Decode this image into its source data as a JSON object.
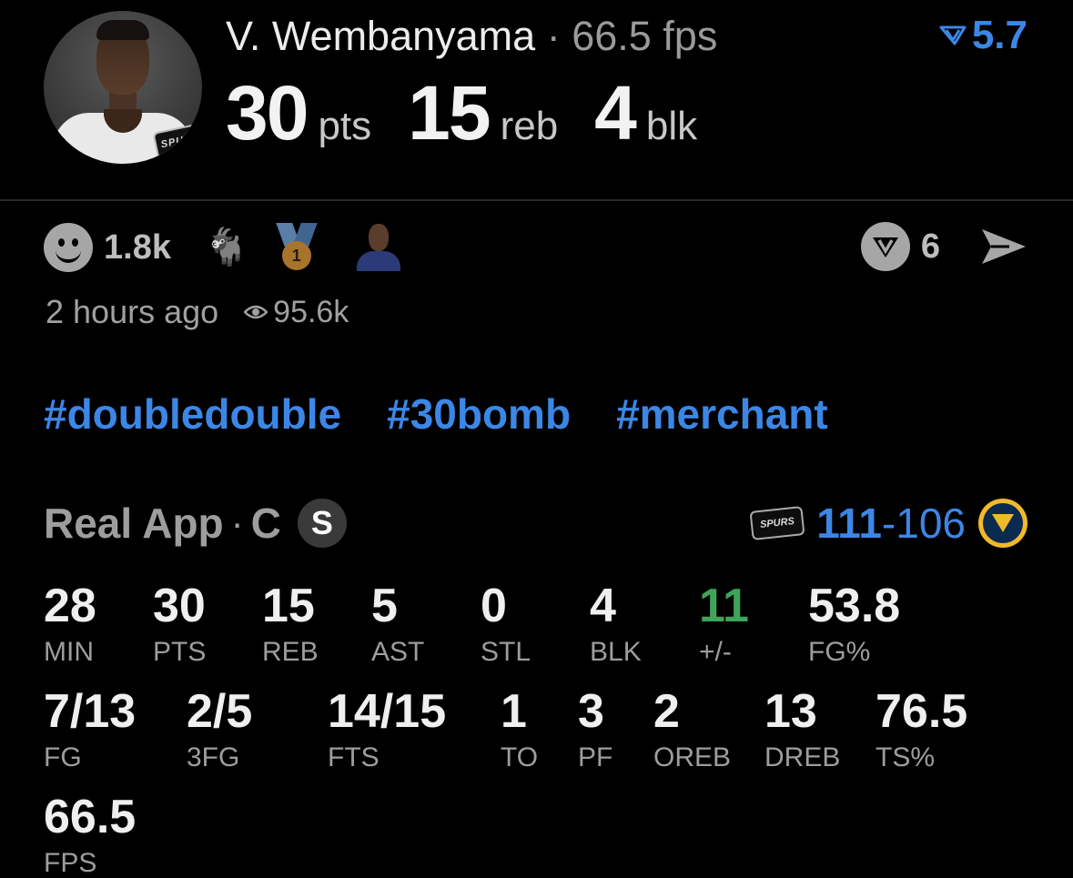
{
  "player": {
    "name": "V. Wembanyama",
    "separator": "·",
    "fps_text": "66.5 fps",
    "rating": "5.7",
    "headline": [
      {
        "value": "30",
        "unit": "pts"
      },
      {
        "value": "15",
        "unit": "reb"
      },
      {
        "value": "4",
        "unit": "blk"
      }
    ],
    "team_badge": "SPURS"
  },
  "reactions": {
    "count": "1.8k",
    "icons": [
      "smiley-icon",
      "goat-icon",
      "medal-icon",
      "player-avatar-icon"
    ],
    "medal_number": "1",
    "v_count": "6"
  },
  "meta": {
    "time": "2 hours ago",
    "views": "95.6k"
  },
  "tags": [
    "#doubledouble",
    "#30bomb",
    "#merchant"
  ],
  "game": {
    "source": "Real App",
    "dot": "·",
    "position": "C",
    "badge": "S",
    "team_logo": "SPURS",
    "score_team": "111",
    "score_dash": "-",
    "score_opp": "106"
  },
  "stats": [
    {
      "value": "28",
      "label": "MIN"
    },
    {
      "value": "30",
      "label": "PTS"
    },
    {
      "value": "15",
      "label": "REB"
    },
    {
      "value": "5",
      "label": "AST"
    },
    {
      "value": "0",
      "label": "STL"
    },
    {
      "value": "4",
      "label": "BLK"
    },
    {
      "value": "11",
      "label": "+/-"
    },
    {
      "value": "53.8",
      "label": "FG%"
    },
    {
      "value": "7/13",
      "label": "FG"
    },
    {
      "value": "2/5",
      "label": "3FG"
    },
    {
      "value": "14/15",
      "label": "FTS"
    },
    {
      "value": "1",
      "label": "TO"
    },
    {
      "value": "3",
      "label": "PF"
    },
    {
      "value": "2",
      "label": "OREB"
    },
    {
      "value": "13",
      "label": "DREB"
    },
    {
      "value": "76.5",
      "label": "TS%"
    },
    {
      "value": "66.5",
      "label": "FPS"
    }
  ],
  "colors": {
    "accent_blue": "#3c86e6",
    "plus_minus_green": "#3fa45a",
    "background": "#000000"
  }
}
